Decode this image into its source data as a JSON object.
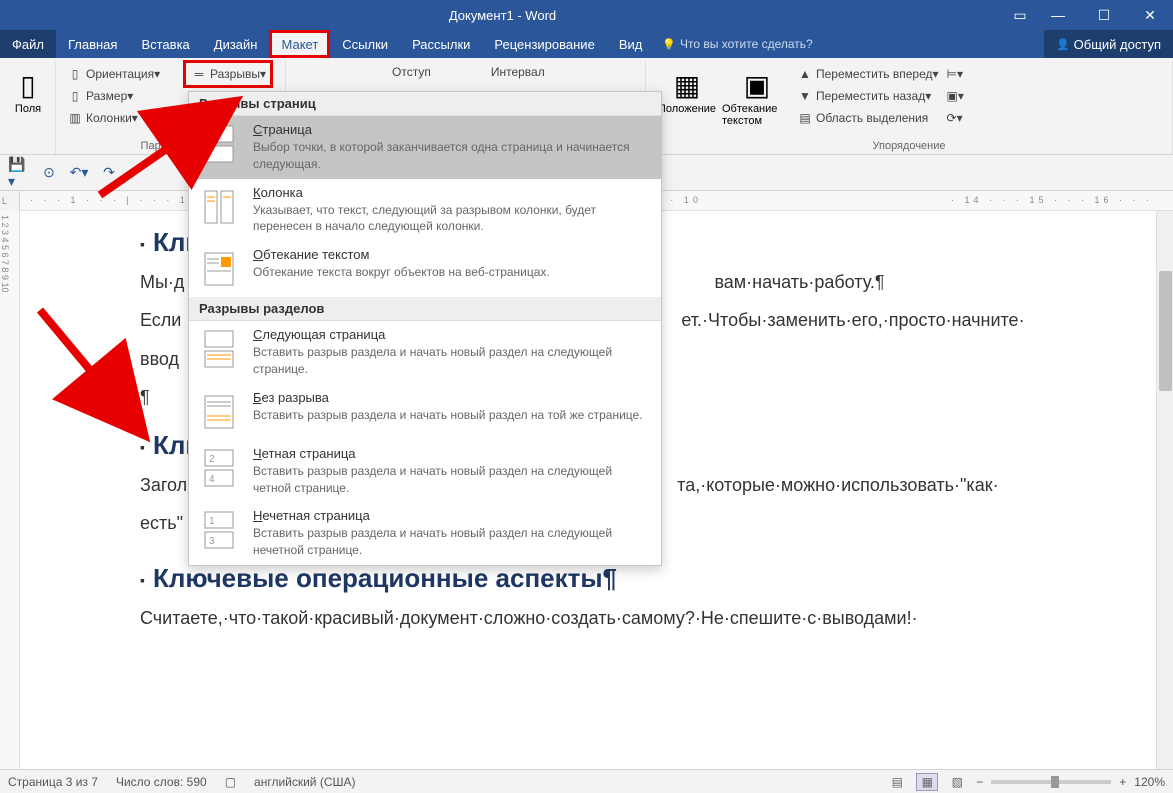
{
  "titlebar": {
    "title": "Документ1 - Word"
  },
  "tabs": {
    "file": "Файл",
    "items": [
      "Главная",
      "Вставка",
      "Дизайн",
      "Макет",
      "Ссылки",
      "Рассылки",
      "Рецензирование",
      "Вид"
    ],
    "active_index": 3,
    "tell_me": "Что вы хотите сделать?",
    "share": "Общий доступ"
  },
  "ribbon": {
    "group1": {
      "margins": "Поля",
      "orientation": "Ориентация",
      "size": "Размер",
      "columns": "Колонки",
      "breaks": "Разрывы",
      "label": "Параметр..."
    },
    "group2": {
      "indent": "Отступ",
      "interval": "Интервал"
    },
    "group3": {
      "position": "Положение",
      "wrap": "Обтекание текстом",
      "forward": "Переместить вперед",
      "backward": "Переместить назад",
      "selection": "Область выделения",
      "label": "Упорядочение"
    }
  },
  "dropdown": {
    "section1": "Разрывы страниц",
    "item1": {
      "title": "Страница",
      "desc": "Выбор точки, в которой заканчивается одна страница и начинается следующая."
    },
    "item2": {
      "title": "Колонка",
      "desc": "Указывает, что текст, следующий за разрывом колонки, будет перенесен в начало следующей колонки."
    },
    "item3": {
      "title": "Обтекание текстом",
      "desc": "Обтекание текста вокруг объектов на веб-страницах."
    },
    "section2": "Разрывы разделов",
    "item4": {
      "title": "Следующая страница",
      "desc": "Вставить разрыв раздела и начать новый раздел на следующей странице."
    },
    "item5": {
      "title": "Без разрыва",
      "desc": "Вставить разрыв раздела и начать новый раздел на той же странице."
    },
    "item6": {
      "title": "Четная страница",
      "desc": "Вставить разрыв раздела и начать новый раздел на следующей четной странице."
    },
    "item7": {
      "title": "Нечетная страница",
      "desc": "Вставить разрыв раздела и начать новый раздел на следующей нечетной странице."
    }
  },
  "document": {
    "h1": "Клю",
    "p1a": "Мы·д",
    "p1b": "вам·начать·работу.¶",
    "p2a": "Если",
    "p2b": "ет.·Чтобы·заменить·его,·просто·начните·",
    "p3a": "ввод",
    "p4": "¶",
    "h2": "Клю",
    "p5a": "Загол",
    "p5b": "та,·которые·можно·использовать·\"как·",
    "p6a": "есть\"",
    "h3": "Ключевые операционные аспекты¶",
    "p7": "Считаете,·что·такой·красивый·документ·сложно·создать·самому?·Не·спешите·с·выводами!·"
  },
  "ruler": {
    "right": "· 14 · · · 15 · · · 16 · · ·"
  },
  "statusbar": {
    "page": "Страница 3 из 7",
    "words": "Число слов: 590",
    "lang": "английский (США)",
    "zoom": "120%"
  }
}
